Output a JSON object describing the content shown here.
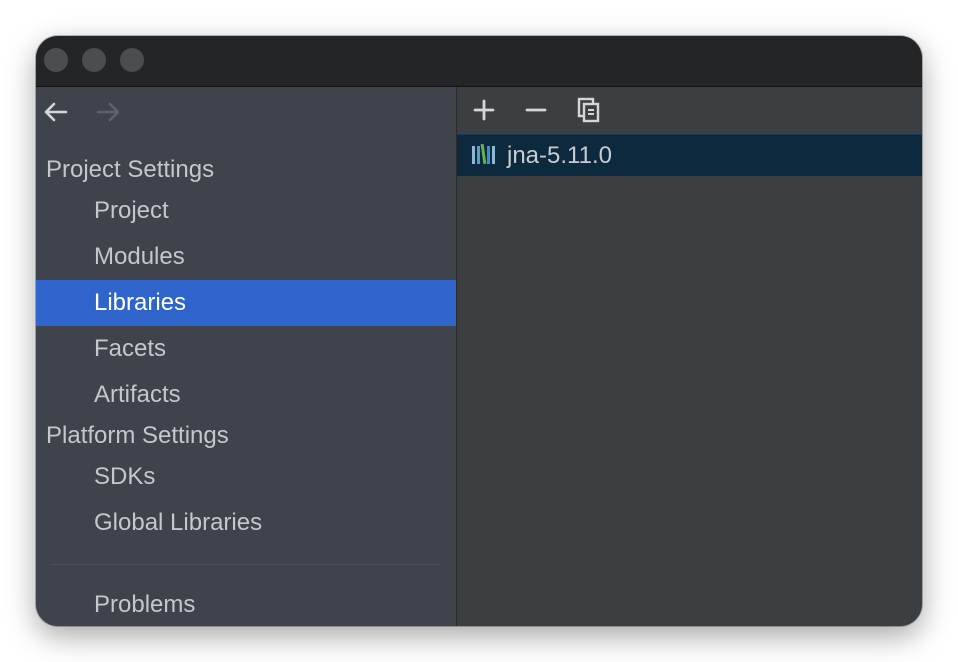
{
  "sidebar": {
    "sections": [
      {
        "header": "Project Settings",
        "items": [
          {
            "label": "Project",
            "selected": false
          },
          {
            "label": "Modules",
            "selected": false
          },
          {
            "label": "Libraries",
            "selected": true
          },
          {
            "label": "Facets",
            "selected": false
          },
          {
            "label": "Artifacts",
            "selected": false
          }
        ]
      },
      {
        "header": "Platform Settings",
        "items": [
          {
            "label": "SDKs",
            "selected": false
          },
          {
            "label": "Global Libraries",
            "selected": false
          }
        ]
      }
    ],
    "problems_label": "Problems"
  },
  "toolbar": {
    "icons": [
      "add-icon",
      "remove-icon",
      "copy-icon"
    ]
  },
  "libraries": [
    {
      "name": "jna-5.11.0",
      "icon": "library-icon",
      "selected": true
    }
  ],
  "colors": {
    "selection": "#2f65ca",
    "selected_row": "#0d293e",
    "sidebar_bg": "#3e434c",
    "main_bg": "#3c3f41",
    "titlebar_bg": "#232526"
  }
}
